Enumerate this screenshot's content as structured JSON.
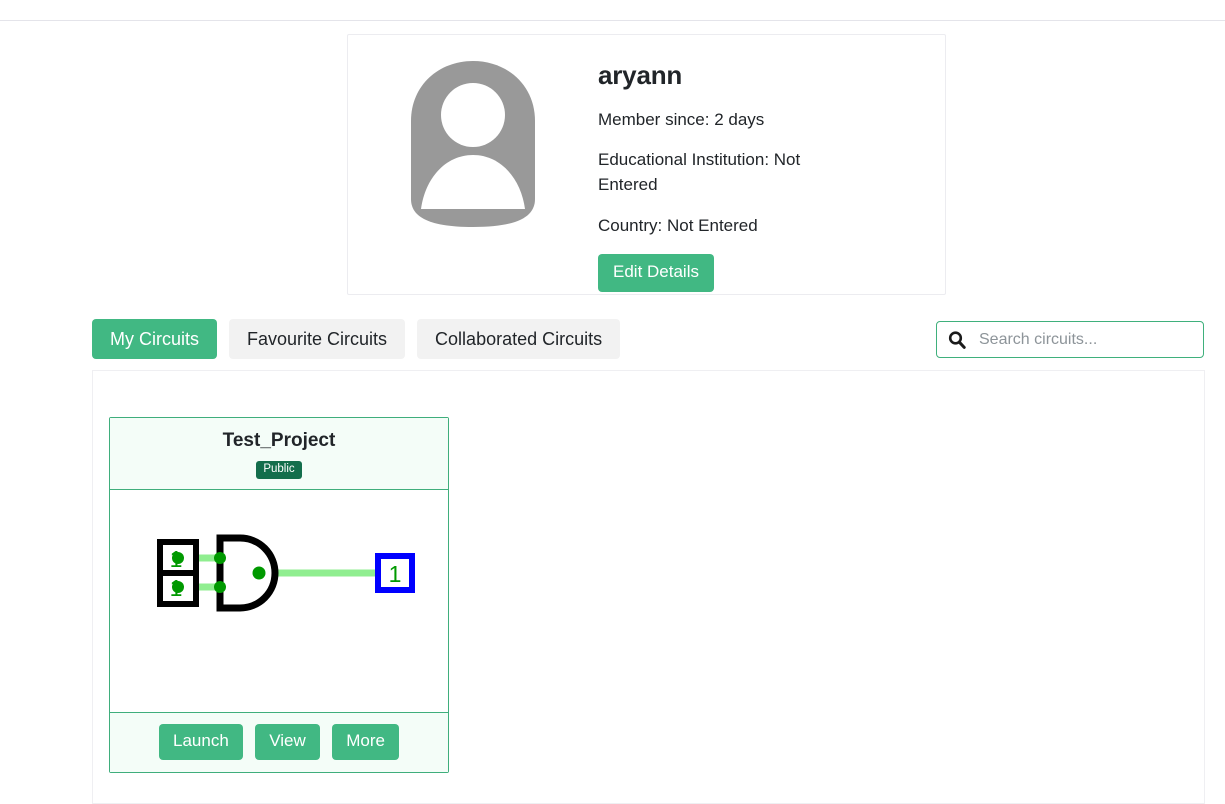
{
  "page": {
    "background": "#ffffff",
    "accent_green": "#41b883",
    "badge_green": "#136e4c",
    "border_gray": "#ececf0"
  },
  "profile": {
    "avatar_icon": "user-avatar-icon",
    "avatar_color": "#999999",
    "username": "aryann",
    "member_since": "Member since: 2 days",
    "educational_institution": "Educational Institution: Not Entered",
    "country": "Country: Not Entered",
    "edit_button": "Edit Details"
  },
  "tabs": [
    {
      "label": "My Circuits",
      "active": true
    },
    {
      "label": "Favourite Circuits",
      "active": false
    },
    {
      "label": "Collaborated Circuits",
      "active": false
    }
  ],
  "search": {
    "icon": "search-icon",
    "placeholder": "Search circuits...",
    "value": ""
  },
  "circuits": [
    {
      "title": "Test_Project",
      "visibility": "Public",
      "buttons": {
        "launch": "Launch",
        "view": "View",
        "more": "More"
      },
      "preview": {
        "type": "logic-circuit",
        "gate": "AND",
        "inputs": [
          {
            "label": "1",
            "value": 1
          },
          {
            "label": "1",
            "value": 1
          }
        ],
        "output": {
          "label": "1",
          "value": 1
        },
        "wire_color": "#90ee90",
        "node_color": "#009900",
        "input_text_color": "#009900",
        "output_border_color": "#0000ff",
        "gate_color": "#000000"
      }
    }
  ]
}
